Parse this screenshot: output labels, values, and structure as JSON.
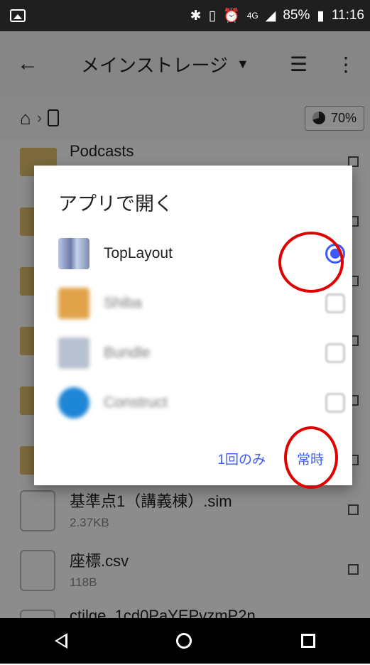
{
  "status": {
    "battery": "85%",
    "time": "11:16",
    "network": "4G"
  },
  "appbar": {
    "title": "メインストレージ"
  },
  "pathbar": {
    "storage_percent": "70%"
  },
  "files": [
    {
      "name": "Podcasts",
      "type": "folder"
    },
    {
      "name": "基準点1（講義棟）.sim",
      "size": "2.37KB",
      "type": "file"
    },
    {
      "name": "座標.csv",
      "size": "118B",
      "type": "file"
    },
    {
      "name": "ctilge_1cd0PaYEPvzmP2n",
      "type": "file"
    }
  ],
  "dialog": {
    "title": "アプリで開く",
    "apps": [
      {
        "name": "TopLayout",
        "selected": true,
        "color": "#9aa7c7"
      },
      {
        "name": "Shiba",
        "selected": false,
        "color": "#e0a34a"
      },
      {
        "name": "Bundle",
        "selected": false,
        "color": "#b7c0cf"
      },
      {
        "name": "Construct",
        "selected": false,
        "color": "#1e86d6"
      }
    ],
    "just_once": "1回のみ",
    "always": "常時"
  }
}
